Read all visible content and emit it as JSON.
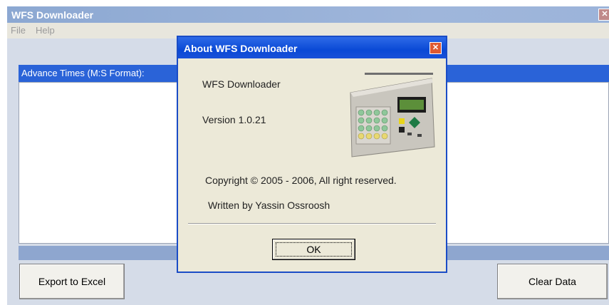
{
  "main_window": {
    "title": "WFS Downloader",
    "close_glyph": "✕",
    "menu": [
      "File",
      "Help"
    ],
    "list_header": "Advance Times (M:S Format):",
    "export_button": "Export to Excel",
    "clear_button": "Clear Data"
  },
  "about_dialog": {
    "title": "About WFS Downloader",
    "close_glyph": "✕",
    "app_name": "WFS Downloader",
    "version": "Version 1.0.21",
    "copyright": "Copyright © 2005 - 2006, All right reserved.",
    "author": "Written by Yassin Ossroosh",
    "ok_button": "OK",
    "image_icon": "wfs-device-image"
  },
  "colors": {
    "dialog_title": "#0a49d6",
    "list_header": "#2a63d8",
    "close_button": "#df5a32"
  }
}
